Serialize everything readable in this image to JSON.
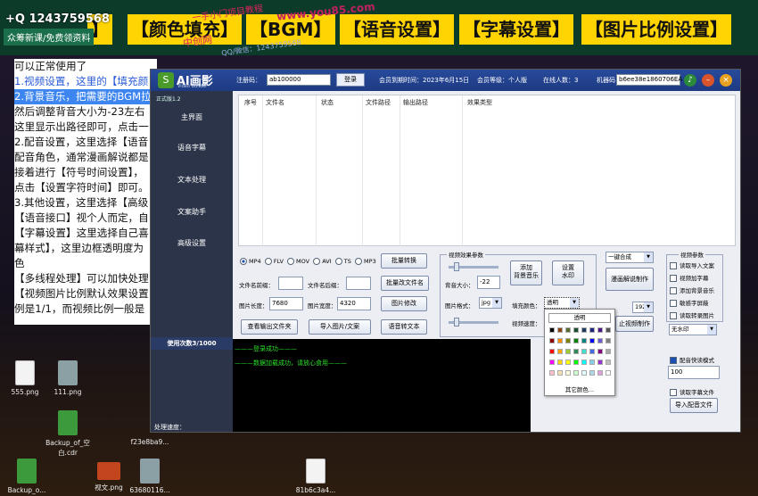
{
  "banner": {
    "tags": [
      "】",
      "【颜色填充】",
      "【BGM】",
      "【语音设置】",
      "【字幕设置】",
      "【图片比例设置】"
    ],
    "watermark_qq": "+Q 1243759568",
    "watermark_sub": "众筹新课/免费领资料",
    "watermark_a": "一手小门项目教程",
    "watermark_b": "中创网",
    "watermark_c": "QQ/微信：1243759568",
    "watermark_url": "www.you85.com"
  },
  "notes": {
    "lines": [
      "可以正常使用了",
      "1.视频设置，这里的【填充颜",
      "2.背景音乐，把需要的BGM拉",
      "然后调整背音大小为-23左右",
      "这里显示出路径即可，点击一",
      "2.配音设置，这里选择【语音",
      "配音角色，通常漫画解说都是",
      "接着进行【符号时间设置】，",
      "点击【设置字符时间】即可。",
      "3.其他设置，这里选择【高级",
      "【语音接口】视个人而定，自",
      "【字幕设置】这里选择自己喜",
      "幕样式】，这里边框透明度为",
      "色",
      "【多线程处理】可以加快处理",
      "【视频图片比例默认效果设置",
      "例是1/1，而视频比例一般是"
    ]
  },
  "desktop_icons": [
    {
      "label": "555.png"
    },
    {
      "label": "111.png"
    },
    {
      "label": "Backup_of_空白.cdr"
    },
    {
      "label": "f23e8ba9..."
    },
    {
      "label": "Backup_o..."
    },
    {
      "label": "视文.png"
    },
    {
      "label": "63680116..."
    },
    {
      "label": "81b6c3a4..."
    }
  ],
  "app": {
    "logo_text": "AI画影",
    "logo_sub": "Video Builder",
    "reg_label": "注册码：",
    "reg_value": "ab100000",
    "login_btn": "登录",
    "expire_label": "会员到期时间：2023年6月15日",
    "member_label": "会员等级：个人版",
    "online_label": "在线人数：3",
    "machine_label": "机器码",
    "machine_value": "b6ee38e1860706EA",
    "version": "正式版1.2",
    "sidebar": [
      "主界面",
      "语音字幕",
      "文本处理",
      "文案助手",
      "高级设置"
    ],
    "usage": "使用次数3/1000",
    "speed_label": "处理速度：",
    "grid_headers": [
      "序号",
      "文件名",
      "状态",
      "文件路径",
      "输出路径",
      "效果类型"
    ],
    "formats": [
      "MP4",
      "FLV",
      "MOV",
      "AVI",
      "TS",
      "MP3"
    ],
    "selected_format": "MP4",
    "batch_convert": "批量转换",
    "prefix_label": "文件名前缀：",
    "suffix_label": "文件名后缀：",
    "batch_rename": "批量改文件名",
    "img_len_label": "图片长度：",
    "img_len_value": "7680",
    "img_w_label": "图片宽度：",
    "img_w_value": "4320",
    "img_edit": "图片修改",
    "view_out": "查看输出文件夹",
    "import_btn": "导入图片/文案",
    "tts_btn": "语音转文本",
    "vfx_title": "视频效果参数",
    "bg_vol_label": "背音大小：",
    "bg_vol_value": "-22",
    "add_music": "添加\n背景音乐",
    "set_wm": "设置\n水印",
    "img_fmt_label": "图片格式：",
    "img_fmt_value": "jpg",
    "fill_label": "填充颜色：",
    "fill_value": "透明",
    "vspeed_label": "视频速度：",
    "popup_top": "透明",
    "popup_more": "其它颜色...",
    "one_click": "一键合成",
    "comic_btn": "漫画解说制作",
    "res_value": "1920*1080",
    "make_btn": "止视频制作",
    "nowm": "无水印",
    "vparams_title": "视频参数",
    "opts": [
      "读取导入文案",
      "视频加字幕",
      "添加背景音乐",
      "敏感字屏蔽",
      "读取转录图片"
    ],
    "quick_label": "配音快读模式",
    "quick_value": "100",
    "read_sub": "读取字幕文件",
    "import_voice": "导入配音文件",
    "console_lines": [
      "———登录成功———",
      "———数据加载成功，请放心食用———"
    ]
  }
}
